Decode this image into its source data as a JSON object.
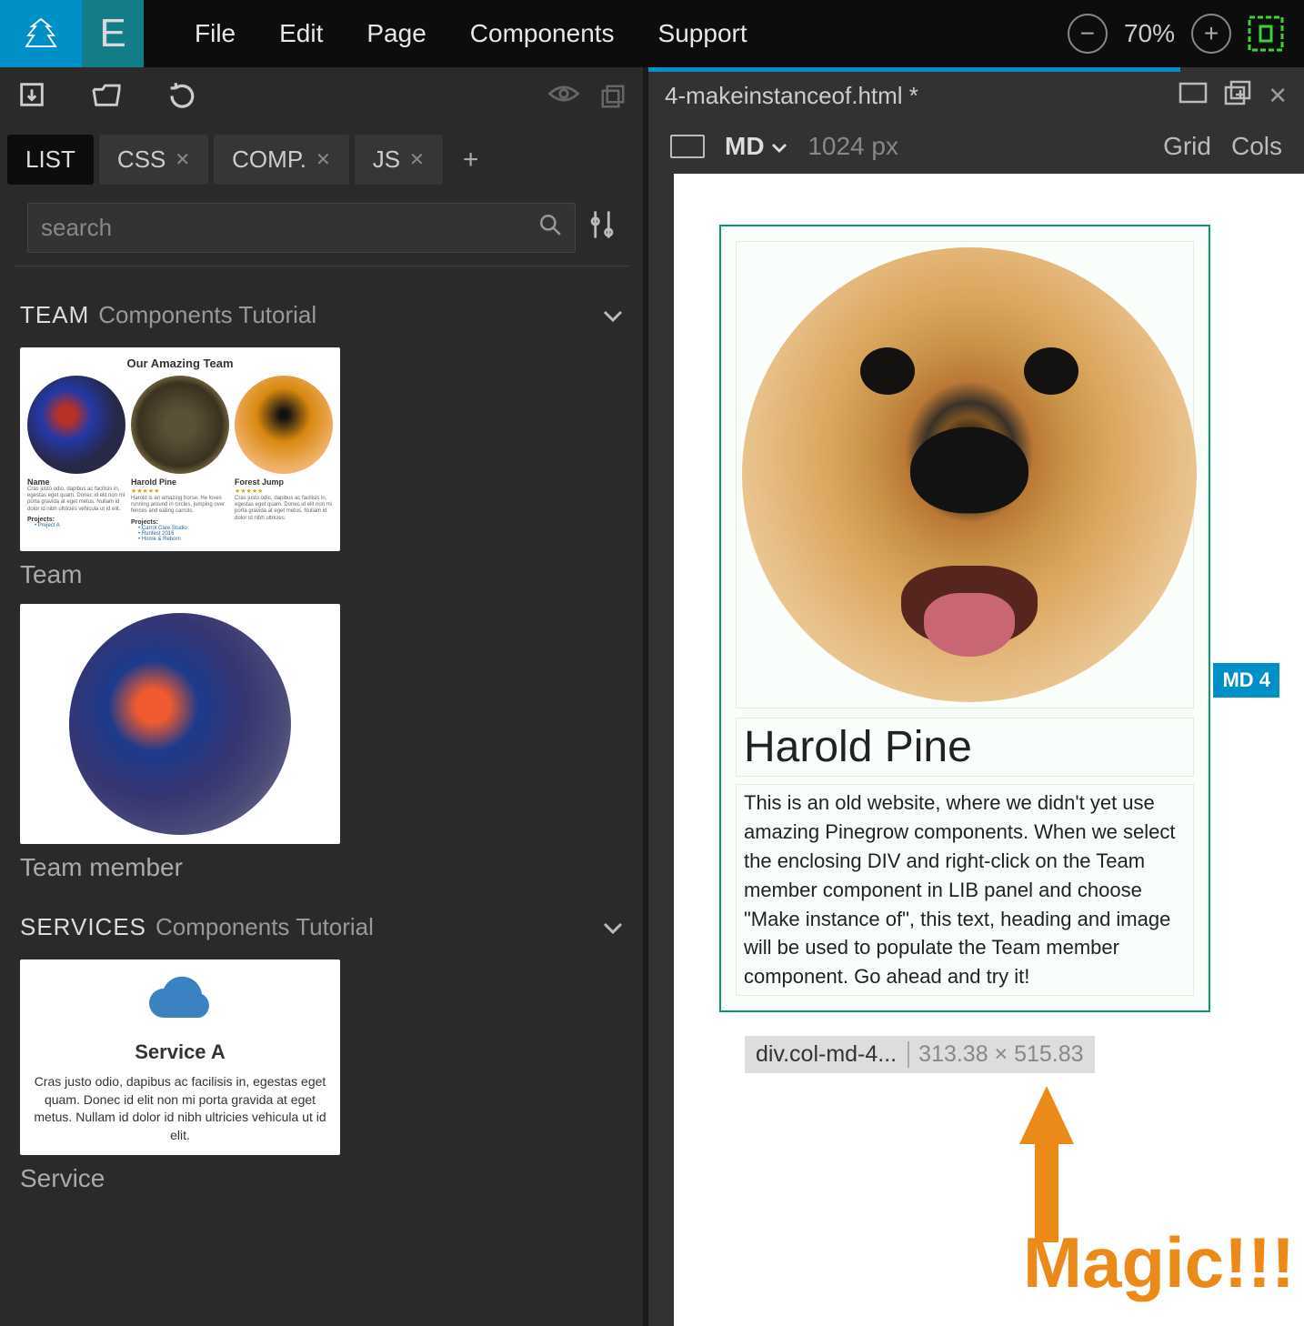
{
  "menu": {
    "items": [
      "File",
      "Edit",
      "Page",
      "Components",
      "Support"
    ]
  },
  "zoom": {
    "value": "70%"
  },
  "left": {
    "tabs": [
      {
        "label": "LIST",
        "active": true,
        "closable": false
      },
      {
        "label": "CSS",
        "active": false,
        "closable": true
      },
      {
        "label": "COMP.",
        "active": false,
        "closable": true
      },
      {
        "label": "JS",
        "active": false,
        "closable": true
      }
    ],
    "search": {
      "placeholder": "search"
    },
    "sections": {
      "team": {
        "title": "TEAM",
        "subtitle": "Components Tutorial",
        "items": [
          {
            "label": "Team",
            "preview": {
              "header": "Our Amazing Team",
              "members": [
                {
                  "name": "Name",
                  "text": "Cras justo odio, dapibus ac facilisis in, egestas eget quam. Donec id elit non mi porta gravida at eget metus. Nullam id dolor id nibh ultricies vehicula ut id elit.",
                  "projects_label": "Projects:",
                  "projects": [
                    "Project A"
                  ]
                },
                {
                  "name": "Harold Pine",
                  "text": "Harold is an amazing horse. He loves running around in circles, jumping over fences and eating carrots.",
                  "projects_label": "Projects:",
                  "projects": [
                    "Carrot Care Studio",
                    "Runfest 2016",
                    "Home & Reborn"
                  ]
                },
                {
                  "name": "Forest Jump",
                  "text": "Cras justo odio, dapibus ac facilisis in, egestas eget quam. Donec id elit non mi porta gravida at eget metus. Nullam id dolor id nibh ultricies.",
                  "projects_label": "",
                  "projects": []
                }
              ]
            }
          },
          {
            "label": "Team member"
          }
        ]
      },
      "services": {
        "title": "SERVICES",
        "subtitle": "Components Tutorial",
        "items": [
          {
            "label": "Service",
            "preview": {
              "title": "Service A",
              "desc": "Cras justo odio, dapibus ac facilisis in, egestas eget quam. Donec id elit non mi porta gravida at eget metus. Nullam id dolor id nibh ultricies vehicula ut id elit."
            }
          }
        ]
      }
    }
  },
  "right": {
    "file": "4-makeinstanceof.html *",
    "view": {
      "breakpoint": "MD",
      "width": "1024 px",
      "grid": "Grid",
      "cols": "Cols"
    },
    "selection": {
      "heading": "Harold Pine",
      "text": "This is an old website, where we didn't yet use amazing Pinegrow components. When we select the enclosing DIV and right-click on the Team member component in LIB panel and choose \"Make instance of\", this text, heading and image will be used to populate the Team member component. Go ahead and try it!",
      "badge": "MD 4",
      "status_path": "div.col-md-4...",
      "status_dim": "313.38 × 515.83"
    },
    "annotation": "Magic!!!"
  }
}
